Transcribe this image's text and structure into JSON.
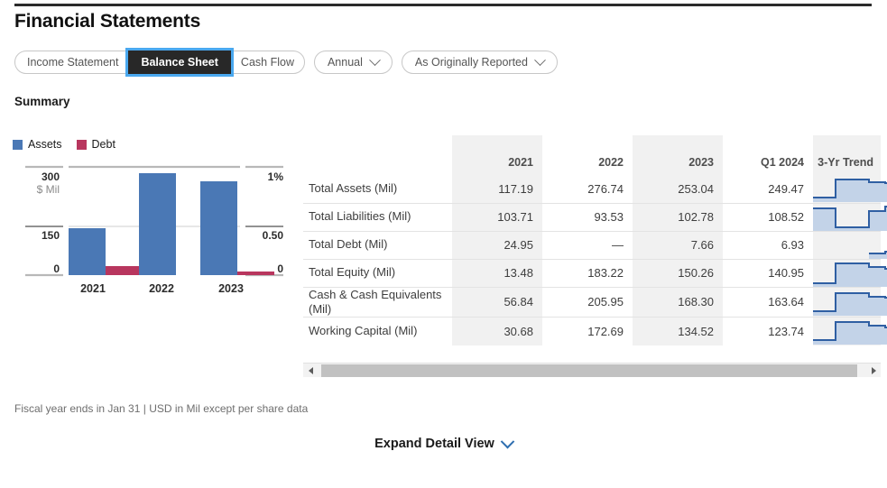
{
  "page": {
    "title": "Financial Statements",
    "summary_label": "Summary",
    "footnote": "Fiscal year ends in Jan 31 | USD in Mil except per share data",
    "expand_label": "Expand Detail View"
  },
  "colors": {
    "assets": "#4a78b5",
    "debt": "#b8365e",
    "accent": "#2f6fb0",
    "focus_ring": "#4aa8ef",
    "selected_tab_bg": "#282828",
    "shade": "#f1f1f1"
  },
  "statement_tabs": [
    {
      "label": "Income Statement",
      "selected": false
    },
    {
      "label": "Balance Sheet",
      "selected": true
    },
    {
      "label": "Cash Flow",
      "selected": false
    }
  ],
  "dropdowns": [
    {
      "label": "Annual"
    },
    {
      "label": "As Originally Reported"
    }
  ],
  "chart_data": {
    "type": "bar",
    "title": "Summary",
    "categories": [
      "2021",
      "2022",
      "2023"
    ],
    "series": [
      {
        "name": "Assets",
        "values": [
          117.19,
          276.74,
          253.04
        ],
        "axis": "left",
        "color": "#4a78b5"
      },
      {
        "name": "Debt",
        "values": [
          24.95,
          0,
          7.66
        ],
        "axis": "right",
        "color": "#b8365e"
      }
    ],
    "left_axis": {
      "ticks": [
        "300",
        "150",
        "0"
      ],
      "unit": "$ Mil",
      "min": 0,
      "max": 300
    },
    "right_axis": {
      "ticks": [
        "1%",
        "0.50",
        "0"
      ],
      "min": 0,
      "max": 1
    },
    "xlabel": "",
    "ylabel": "$ Mil",
    "grid": true,
    "legend_position": "top-left"
  },
  "table": {
    "columns": [
      "",
      "2021",
      "2022",
      "2023",
      "Q1 2024",
      "3-Yr Trend"
    ],
    "rows": [
      {
        "label": "Total Assets (Mil)",
        "values": [
          "117.19",
          "276.74",
          "253.04",
          "249.47"
        ],
        "trend": [
          0.18,
          0.88,
          0.8,
          0.78
        ]
      },
      {
        "label": "Total Liabilities (Mil)",
        "values": [
          "103.71",
          "93.53",
          "102.78",
          "108.52"
        ],
        "trend": [
          0.82,
          0.18,
          0.72,
          0.95
        ]
      },
      {
        "label": "Total Debt (Mil)",
        "values": [
          "24.95",
          "—",
          "7.66",
          "6.93"
        ],
        "trend": [
          0.04,
          0.02,
          0.02,
          0.28
        ]
      },
      {
        "label": "Total Equity (Mil)",
        "values": [
          "13.48",
          "183.22",
          "150.26",
          "140.95"
        ],
        "trend": [
          0.1,
          0.9,
          0.78,
          0.72
        ]
      },
      {
        "label": "Cash & Cash Equivalents (Mil)",
        "values": [
          "56.84",
          "205.95",
          "168.30",
          "163.64"
        ],
        "trend": [
          0.14,
          0.88,
          0.74,
          0.7
        ]
      },
      {
        "label": "Working Capital (Mil)",
        "values": [
          "30.68",
          "172.69",
          "134.52",
          "123.74"
        ],
        "trend": [
          0.12,
          0.88,
          0.72,
          0.66
        ]
      }
    ]
  },
  "scrollbar": {
    "left_arrow": "left-arrow",
    "right_arrow": "right-arrow"
  }
}
